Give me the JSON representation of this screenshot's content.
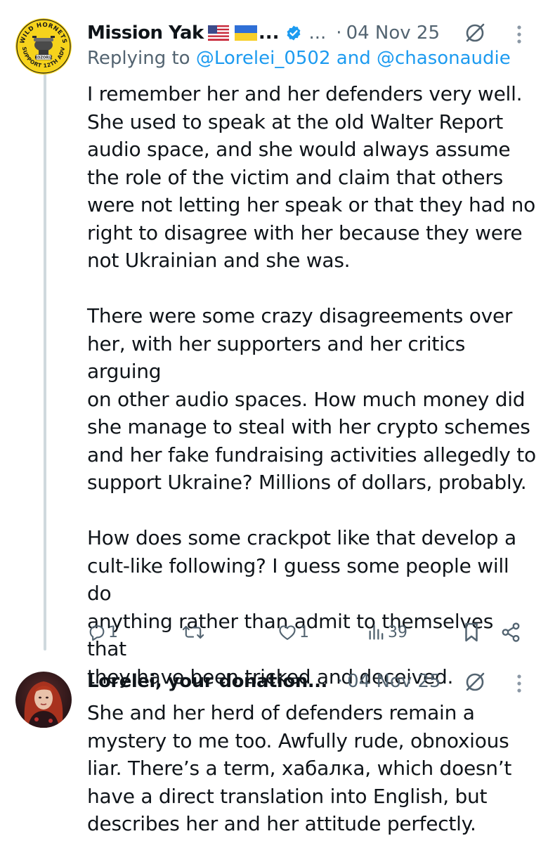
{
  "tweets": [
    {
      "author": {
        "name": "Mission Yak",
        "name_suffix": "...",
        "header_ellipsis": "...",
        "avatar_icon": "wild-hornets-logo",
        "avatar_text_top": "WILD HORNETS",
        "avatar_text_bottom": "SUPPORT 12TH ADV",
        "avatar_badge": "KOZORIZ",
        "verified": true
      },
      "date": "04 Nov 25",
      "replying_prefix": "Replying to",
      "replying_user1": "@Lorelei_0502",
      "replying_and": "and",
      "replying_user2": "@chasonaudie",
      "paragraphs": [
        [
          "I remember her and her defenders very well.",
          "She used to speak at the old Walter Report",
          "audio space, and she would always assume",
          "the role of the victim and claim that others",
          "were not letting her speak or that they had no",
          "right to disagree with her because they were",
          "not Ukrainian and she was."
        ],
        [
          "There were some crazy disagreements over",
          "her, with her supporters and her critics arguing",
          "on other audio spaces. How much money did",
          "she manage to steal with her crypto schemes",
          "and her fake fundraising activities allegedly to",
          "support Ukraine? Millions of dollars, probably."
        ],
        [
          "How does some crackpot like that develop a",
          "cult-like following? I guess some people will do",
          "anything rather than admit to themselves that",
          "they have been tricked and deceived."
        ]
      ],
      "actions": {
        "replies": "1",
        "reposts": "",
        "likes": "1",
        "views": "39"
      }
    },
    {
      "author": {
        "name": "Lorelei, your donation...",
        "avatar_icon": "profile-photo"
      },
      "date": "04 Nov 25",
      "lines": [
        "She and her herd of defenders remain a",
        "mystery to me too. Awfully rude, obnoxious",
        "liar. There’s a term, хабалка, which doesn’t",
        "have a direct translation into English, but",
        "describes her and her attitude perfectly."
      ]
    }
  ],
  "colors": {
    "text": "#0f1419",
    "secondary": "#536471",
    "link": "#1d9bf0",
    "thread_line": "#cfd9de"
  }
}
